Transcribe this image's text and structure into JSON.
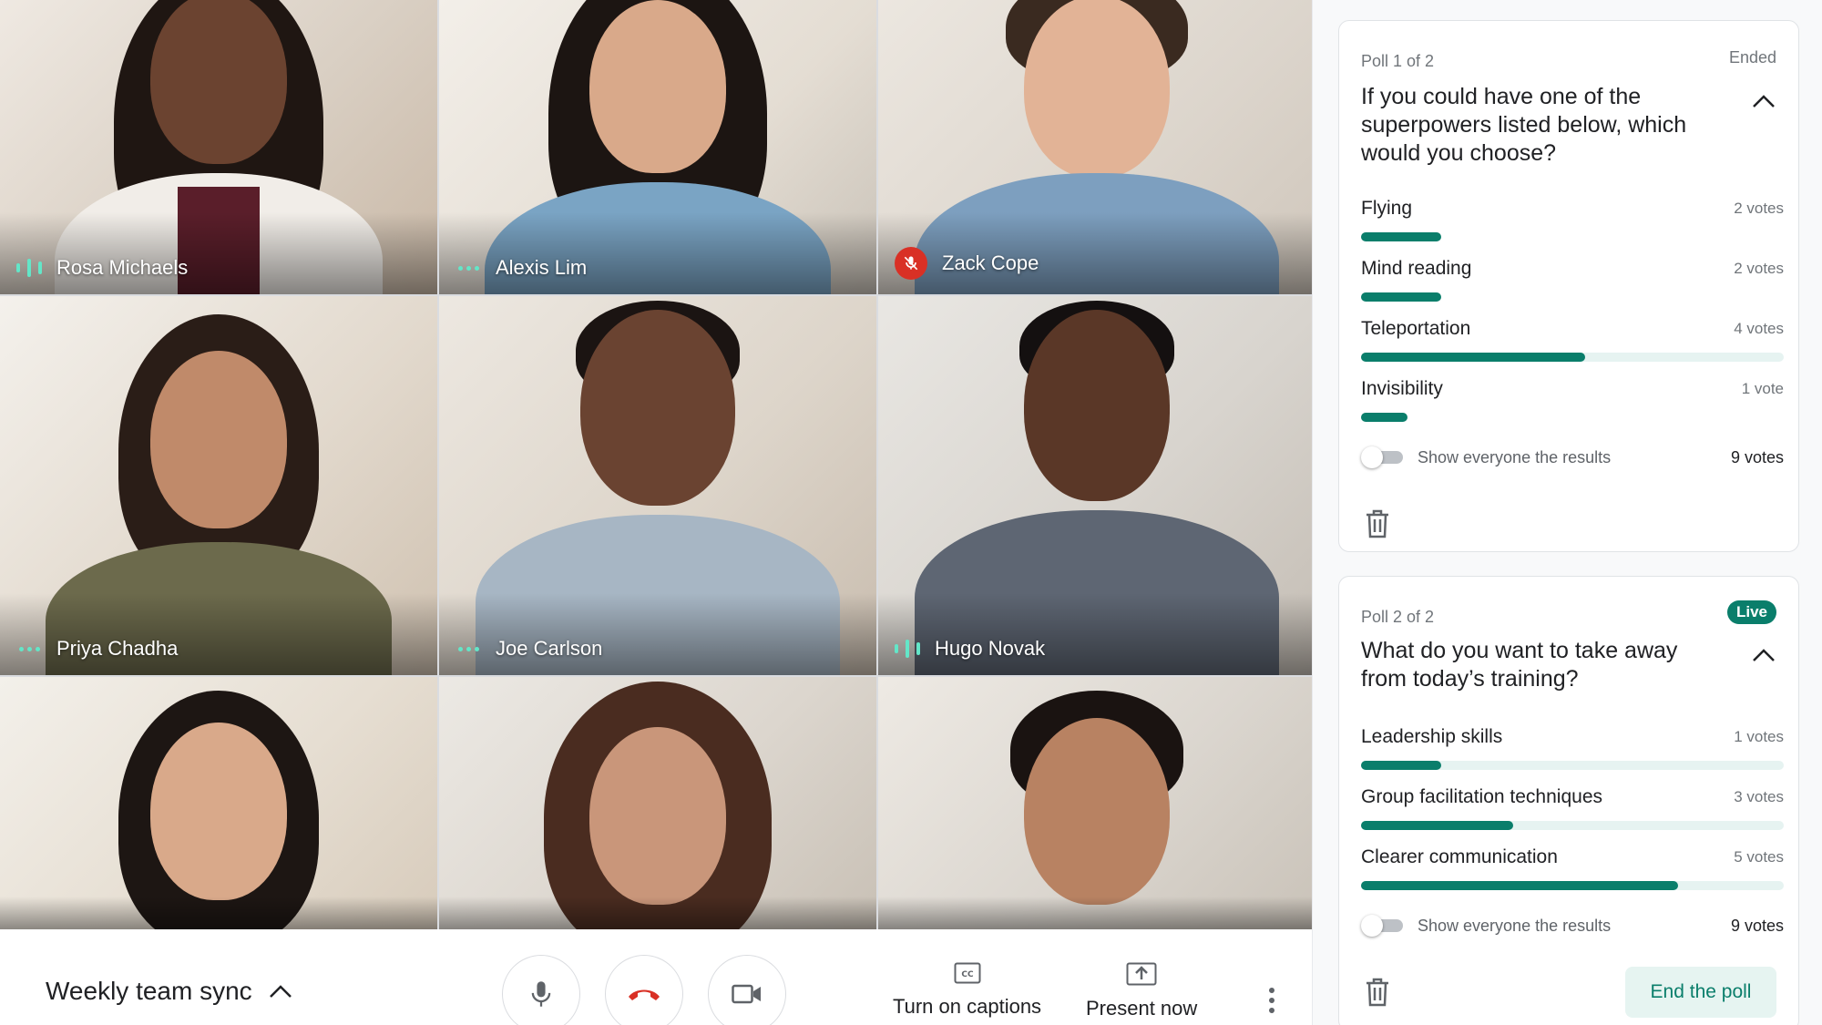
{
  "participants": [
    {
      "name": "Rosa Michaels",
      "indicator": "speaking"
    },
    {
      "name": "Alexis Lim",
      "indicator": "idle"
    },
    {
      "name": "Zack Cope",
      "indicator": "muted"
    },
    {
      "name": "Priya Chadha",
      "indicator": "idle"
    },
    {
      "name": "Joe Carlson",
      "indicator": "idle"
    },
    {
      "name": "Hugo Novak",
      "indicator": "speaking"
    },
    {
      "name": "",
      "indicator": "none"
    },
    {
      "name": "",
      "indicator": "none"
    },
    {
      "name": "",
      "indicator": "none"
    }
  ],
  "bottombar": {
    "meeting_title": "Weekly team sync",
    "captions_label": "Turn on captions",
    "present_label": "Present now",
    "icons": [
      "chevron-up-icon",
      "microphone-icon",
      "hang-up-icon",
      "camera-icon",
      "captions-icon",
      "present-icon",
      "more-vert-icon"
    ]
  },
  "polls": [
    {
      "number": "Poll 1 of 2",
      "status": "Ended",
      "question": "If you could have one of the superpowers listed below, which would you choose?",
      "options": [
        {
          "label": "Flying",
          "votes_text": "2 votes",
          "fraction": 0.19
        },
        {
          "label": "Mind reading",
          "votes_text": "2 votes",
          "fraction": 0.19
        },
        {
          "label": "Teleportation",
          "votes_text": "4 votes",
          "fraction": 0.53
        },
        {
          "label": "Invisibility",
          "votes_text": "1 vote",
          "fraction": 0.11
        }
      ],
      "toggle_label": "Show everyone the results",
      "toggle_on": false,
      "total_votes": "9  votes"
    },
    {
      "number": "Poll 2 of 2",
      "status": "Live",
      "question": "What do you want to take away from today’s training?",
      "options": [
        {
          "label": "Leadership skills",
          "votes_text": "1 votes",
          "fraction": 0.19
        },
        {
          "label": "Group facilitation techniques",
          "votes_text": "3 votes",
          "fraction": 0.36
        },
        {
          "label": "Clearer communication",
          "votes_text": "5 votes",
          "fraction": 0.75
        }
      ],
      "toggle_label": "Show everyone the results",
      "toggle_on": false,
      "total_votes": "9  votes",
      "end_label": "End the poll"
    }
  ],
  "colors": {
    "accent": "#0a7e6b",
    "track": "#e6f3f1",
    "speaking": "#63e6c8",
    "muted": "#d93025",
    "hangup": "#d93025"
  }
}
